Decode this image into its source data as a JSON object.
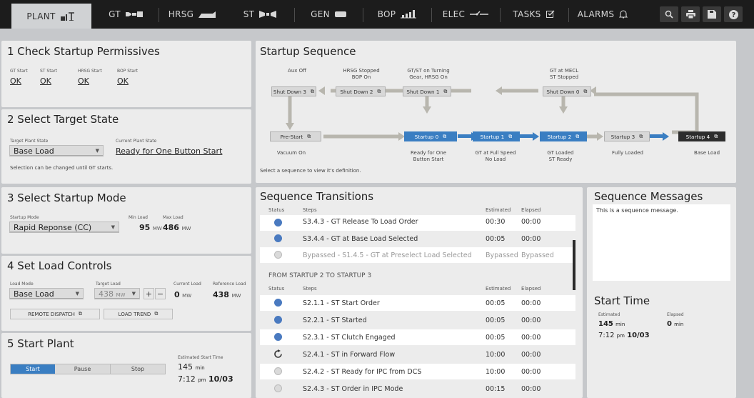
{
  "nav": {
    "tabs": [
      "PLANT",
      "GT",
      "HRSG",
      "ST",
      "GEN",
      "BOP",
      "ELEC",
      "TASKS",
      "ALARMS"
    ],
    "active": "PLANT"
  },
  "check": {
    "title": "1 Check Startup Permissives",
    "items": [
      {
        "label": "GT Start",
        "value": "OK"
      },
      {
        "label": "ST Start",
        "value": "OK"
      },
      {
        "label": "HRSG Start",
        "value": "OK"
      },
      {
        "label": "BOP Start",
        "value": "OK"
      }
    ]
  },
  "target": {
    "title": "2 Select Target State",
    "target_label": "Target Plant State",
    "target_value": "Base Load",
    "current_label": "Current Plant State",
    "current_value": "Ready for One Button Start",
    "note": "Selection can be changed until GT starts."
  },
  "mode": {
    "title": "3 Select Startup Mode",
    "mode_label": "Startup Mode",
    "mode_value": "Rapid Reponse (CC)",
    "min_label": "Min Load",
    "min_value": "95",
    "max_label": "Max Load",
    "max_value": "486",
    "unit": "MW"
  },
  "load": {
    "title": "4 Set Load Controls",
    "mode_label": "Load Mode",
    "mode_value": "Base Load",
    "target_label": "Target Load",
    "target_value": "438",
    "current_label": "Current Load",
    "current_value": "0",
    "ref_label": "Reference Load",
    "ref_value": "438",
    "unit": "MW",
    "unit_caps": "MW",
    "plus": "+",
    "minus": "−",
    "remote": "REMOTE DISPATCH",
    "trend": "LOAD TREND"
  },
  "start": {
    "title": "5 Start Plant",
    "start": "Start",
    "pause": "Pause",
    "stop": "Stop",
    "est_label": "Estimated Start Time",
    "est_value": "145",
    "est_unit": "min",
    "time": "7:12",
    "ampm": "pm",
    "date": "10/03"
  },
  "sequence": {
    "title": "Startup Sequence",
    "note": "Select a sequence to view it's definition.",
    "shutdown": [
      "Shut Down 3",
      "Shut Down 2",
      "Shut Down 1",
      "Shut Down 0"
    ],
    "shut_caps": [
      "Aux Off",
      "HRSG Stopped\nBOP On",
      "GT/ST on Turning\nGear, HRSG On",
      "GT at MECL\nST Stopped"
    ],
    "startup": [
      "Pre-Start",
      "Startup 0",
      "Startup 1",
      "Startup 2",
      "Startup 3",
      "Startup 4"
    ],
    "start_caps": [
      "Vacuum On",
      "Ready for One\nButton Start",
      "GT at Full Speed\nNo Load",
      "GT Loaded\nST Ready",
      "Fully Loaded",
      "Base Load"
    ]
  },
  "transitions": {
    "title": "Sequence Transitions",
    "headers": [
      "Status",
      "Steps",
      "Estimated",
      "Elapsed"
    ],
    "rows_a": [
      {
        "step": "S3.4.3 - GT Release To Load Order",
        "est": "00:30",
        "el": "00:00",
        "status": "blue"
      },
      {
        "step": "S3.4.4 - GT at Base Load Selected",
        "est": "00:05",
        "el": "00:00",
        "status": "blue"
      },
      {
        "step": "Bypassed - S1.4.5 - GT at Preselect Load Selected",
        "est": "Bypassed",
        "el": "Bypassed",
        "status": "grey"
      }
    ],
    "group": "FROM STARTUP 2 TO STARTUP 3",
    "rows_b": [
      {
        "step": "S2.1.1 - ST Start Order",
        "est": "00:05",
        "el": "00:00",
        "status": "blue"
      },
      {
        "step": "S2.2.1 - ST Started",
        "est": "00:05",
        "el": "00:00",
        "status": "blue"
      },
      {
        "step": "S2.3.1 - ST Clutch Engaged",
        "est": "00:05",
        "el": "00:00",
        "status": "blue"
      },
      {
        "step": "S2.4.1 - ST in Forward Flow",
        "est": "10:00",
        "el": "00:00",
        "status": "spin"
      },
      {
        "step": "S2.4.2 - ST Ready for IPC from DCS",
        "est": "10:00",
        "el": "00:00",
        "status": "grey"
      },
      {
        "step": "S2.4.3 - ST Order in IPC Mode",
        "est": "00:15",
        "el": "00:00",
        "status": "grey"
      }
    ]
  },
  "messages": {
    "title": "Sequence Messages",
    "text": "This is a sequence message."
  },
  "starttime": {
    "title": "Start Time",
    "est_label": "Estimated",
    "el_label": "Elapsed",
    "est_value": "145",
    "el_value": "0",
    "unit": "min",
    "time": "7:12",
    "ampm": "pm",
    "date": "10/03"
  },
  "colors": {
    "accent": "#3a7ec2",
    "nav": "#1c1c1c",
    "panel": "#ececec"
  }
}
